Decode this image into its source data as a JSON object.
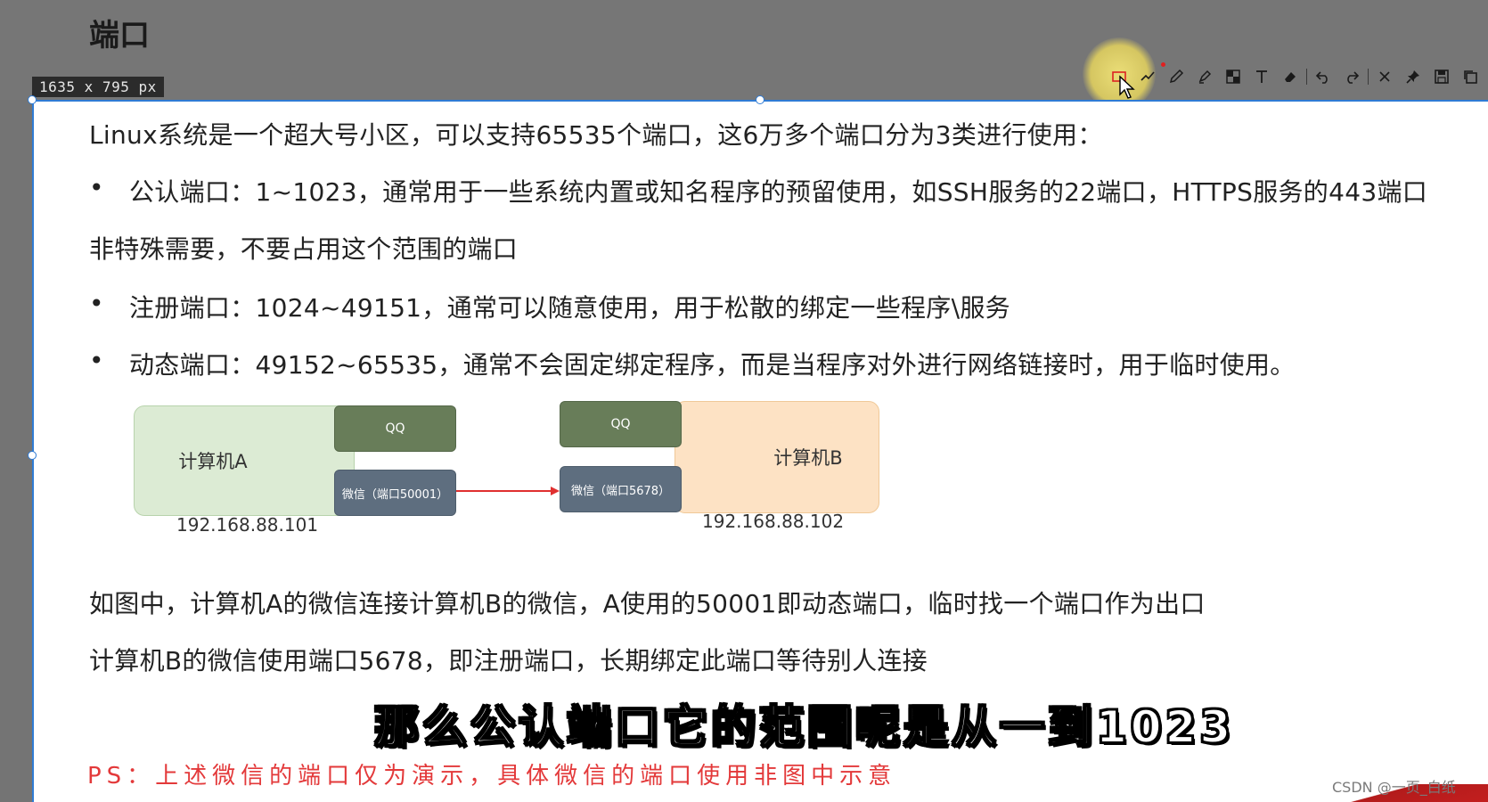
{
  "page": {
    "title": "端口"
  },
  "capture": {
    "size_label": "1635 x 795  px"
  },
  "toolbar": {
    "tools": [
      {
        "name": "rectangle-tool-icon"
      },
      {
        "name": "line-tool-icon"
      },
      {
        "name": "pencil-tool-icon"
      },
      {
        "name": "marker-tool-icon"
      },
      {
        "name": "mosaic-tool-icon"
      },
      {
        "name": "text-tool-icon",
        "glyph": "T"
      },
      {
        "name": "eraser-tool-icon"
      },
      {
        "name": "undo-icon"
      },
      {
        "name": "redo-icon"
      },
      {
        "name": "close-icon"
      },
      {
        "name": "pin-icon"
      },
      {
        "name": "save-icon"
      },
      {
        "name": "copy-icon"
      }
    ]
  },
  "content": {
    "intro": "Linux系统是一个超大号小区，可以支持65535个端口，这6万多个端口分为3类进行使用：",
    "bullet1": "公认端口：1~1023，通常用于一些系统内置或知名程序的预留使用，如SSH服务的22端口，HTTPS服务的443端口",
    "bullet1_cont": "非特殊需要，不要占用这个范围的端口",
    "bullet2": "注册端口：1024~49151，通常可以随意使用，用于松散的绑定一些程序\\服务",
    "bullet3": "动态端口：49152~65535，通常不会固定绑定程序，而是当程序对外进行网络链接时，用于临时使用。",
    "bullet_char": "•",
    "explain1": "如图中，计算机A的微信连接计算机B的微信，A使用的50001即动态端口，临时找一个端口作为出口",
    "explain2": "计算机B的微信使用端口5678，即注册端口，长期绑定此端口等待别人连接"
  },
  "diagram": {
    "computer_a": "计算机A",
    "computer_b": "计算机B",
    "qq_a": "QQ",
    "qq_b": "QQ",
    "wechat_a": "微信（端口50001）",
    "wechat_b": "微信（端口5678）",
    "ip_a": "192.168.88.101",
    "ip_b": "192.168.88.102",
    "arrow_color": "#e03030"
  },
  "subtitle": "那么公认端口它的范围呢是从一到1023",
  "ps_note": "PS：上述微信的端口仅为演示，具体微信的端口使用非图中示意",
  "watermark": "CSDN @一页_白纸"
}
